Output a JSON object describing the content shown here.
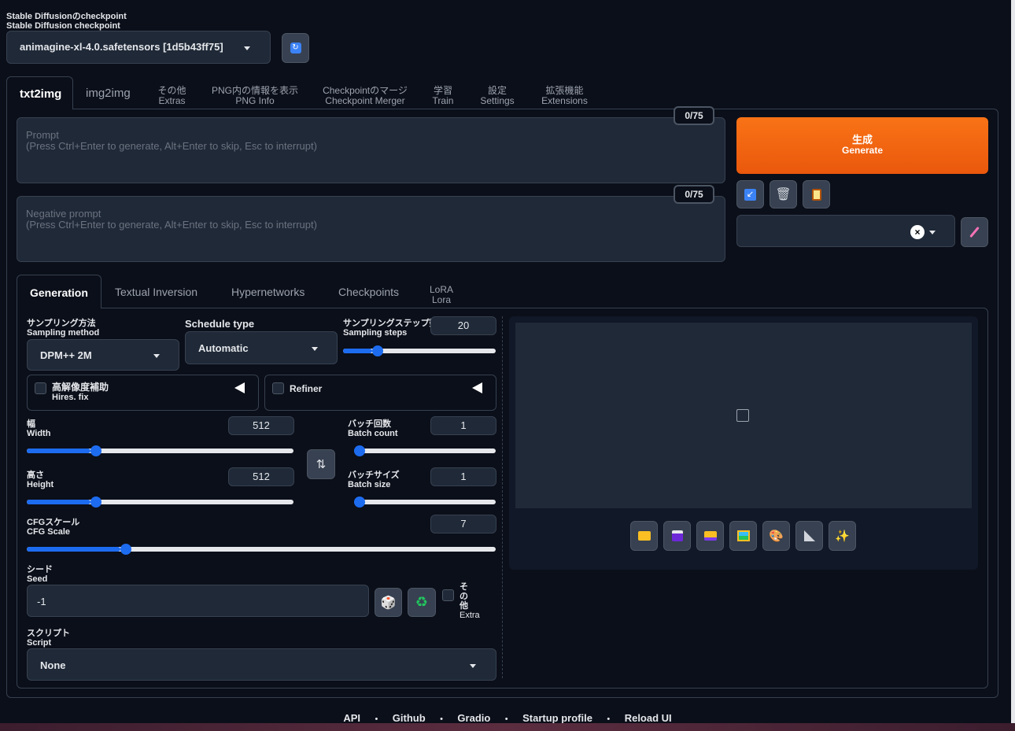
{
  "checkpoint": {
    "label_ja": "Stable Diffusionのcheckpoint",
    "label_en": "Stable Diffusion checkpoint",
    "value": "animagine-xl-4.0.safetensors [1d5b43ff75]",
    "refresh_icon": "refresh-icon"
  },
  "main_tabs": [
    {
      "label": "txt2img",
      "sub": ""
    },
    {
      "label": "img2img",
      "sub": ""
    },
    {
      "label": "その他",
      "sub": "Extras"
    },
    {
      "label": "PNG内の情報を表示",
      "sub": "PNG Info"
    },
    {
      "label": "Checkpointのマージ",
      "sub": "Checkpoint Merger"
    },
    {
      "label": "学習",
      "sub": "Train"
    },
    {
      "label": "設定",
      "sub": "Settings"
    },
    {
      "label": "拡張機能",
      "sub": "Extensions"
    }
  ],
  "prompt": {
    "counter": "0/75",
    "placeholder_1": "Prompt",
    "placeholder_2": "(Press Ctrl+Enter to generate, Alt+Enter to skip, Esc to interrupt)"
  },
  "negative_prompt": {
    "counter": "0/75",
    "placeholder_1": "Negative prompt",
    "placeholder_2": "(Press Ctrl+Enter to generate, Alt+Enter to skip, Esc to interrupt)"
  },
  "generate": {
    "label_ja": "生成",
    "label_en": "Generate",
    "color": "#f97316"
  },
  "sub_tabs": [
    {
      "label": "Generation",
      "sub": ""
    },
    {
      "label": "Textual Inversion",
      "sub": ""
    },
    {
      "label": "Hypernetworks",
      "sub": ""
    },
    {
      "label": "Checkpoints",
      "sub": ""
    },
    {
      "label": "LoRA",
      "sub": "Lora"
    }
  ],
  "sampling_method": {
    "label_ja": "サンプリング方法",
    "label_en": "Sampling method",
    "value": "DPM++ 2M"
  },
  "schedule_type": {
    "label": "Schedule type",
    "value": "Automatic"
  },
  "sampling_steps": {
    "label_ja": "サンプリングステップ数",
    "label_en": "Sampling steps",
    "value": "20",
    "fraction": 0.19
  },
  "hires": {
    "label_ja": "高解像度補助",
    "label_en": "Hires. fix"
  },
  "refiner": {
    "label": "Refiner"
  },
  "width": {
    "label_ja": "幅",
    "label_en": "Width",
    "value": "512",
    "fraction": 0.24
  },
  "height": {
    "label_ja": "高さ",
    "label_en": "Height",
    "value": "512",
    "fraction": 0.24
  },
  "batch_count": {
    "label_ja": "バッチ回数",
    "label_en": "Batch count",
    "value": "1",
    "fraction": 0.0
  },
  "batch_size": {
    "label_ja": "バッチサイズ",
    "label_en": "Batch size",
    "value": "1",
    "fraction": 0.0
  },
  "cfg": {
    "label_ja": "CFGスケール",
    "label_en": "CFG Scale",
    "value": "7",
    "fraction": 0.2
  },
  "seed": {
    "label_ja": "シード",
    "label_en": "Seed",
    "value": "-1"
  },
  "extra": {
    "label_ja": "その他",
    "label_en": "Extra"
  },
  "script": {
    "label_ja": "スクリプト",
    "label_en": "Script",
    "value": "None"
  },
  "footer": [
    "API",
    "Github",
    "Gradio",
    "Startup profile",
    "Reload UI"
  ]
}
